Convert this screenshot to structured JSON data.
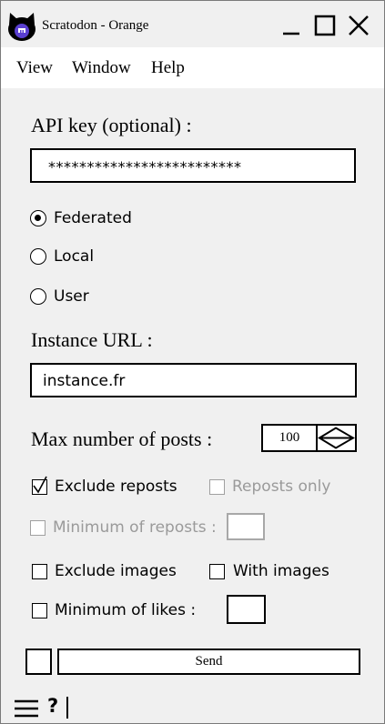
{
  "window": {
    "title": "Scratodon - Orange",
    "logo_icon": "scratodon-cat-logo",
    "controls": [
      "minimize-icon",
      "maximize-icon",
      "close-icon"
    ]
  },
  "menu": {
    "view": "View",
    "window": "Window",
    "help": "Help"
  },
  "form": {
    "api_key_label": "API key (optional) :",
    "api_key_value": "*************************",
    "timeline_options": [
      {
        "label": "Federated",
        "selected": true
      },
      {
        "label": "Local",
        "selected": false
      },
      {
        "label": "User",
        "selected": false
      }
    ],
    "instance_label": "Instance URL :",
    "instance_value": "instance.fr",
    "max_posts_label": "Max number of posts :",
    "max_posts_value": "100",
    "exclude_reposts_label": "Exclude reposts",
    "exclude_reposts_checked": true,
    "reposts_only_label": "Reposts only",
    "reposts_only_enabled": false,
    "min_reposts_label": "Minimum of reposts :",
    "min_reposts_enabled": false,
    "exclude_images_label": "Exclude images",
    "with_images_label": "With images",
    "min_likes_label": "Minimum of likes :"
  },
  "actions": {
    "send_label": "Send"
  },
  "footer": {
    "help_label": "?",
    "menu_icon": "hamburger-icon"
  },
  "colors": {
    "window_bg": "#f0f0f0",
    "menubar_bg": "#ffffff",
    "disabled_text": "#9a9a9a",
    "logo_accent": "#5a3fd0"
  }
}
